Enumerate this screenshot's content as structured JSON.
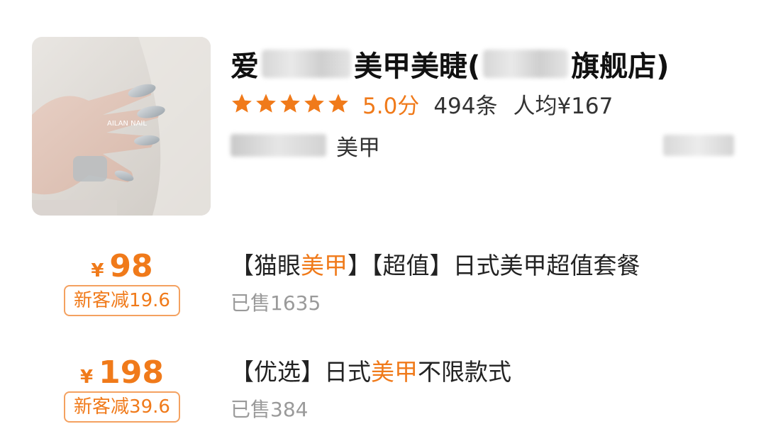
{
  "shop": {
    "name_start": "爱",
    "name_middle": "美甲美睫(",
    "name_end": "旗舰店)",
    "rating_stars": 5,
    "star_color": "#f07a1a",
    "score": "5.0分",
    "reviews": "494条",
    "avg_price": "人均¥167",
    "category": "美甲",
    "thumbnail_caption": "AILAN NAIL"
  },
  "deals": [
    {
      "currency": "¥",
      "price": "98",
      "discount": "新客减19.6",
      "title_prefix": "【猫眼",
      "title_highlight": "美甲",
      "title_suffix": "】【超值】日式美甲超值套餐",
      "sold": "已售1635"
    },
    {
      "currency": "¥",
      "price": "198",
      "discount": "新客减39.6",
      "title_prefix": "【优选】日式",
      "title_highlight": "美甲",
      "title_suffix": "不限款式",
      "sold": "已售384"
    }
  ],
  "colors": {
    "accent": "#f07a1a",
    "text": "#222222",
    "muted": "#9a9a9a"
  }
}
